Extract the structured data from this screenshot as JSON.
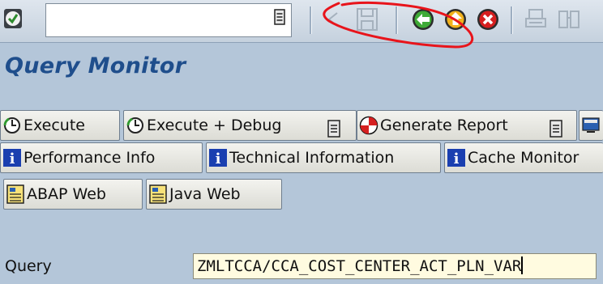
{
  "toolbar": {
    "command_field_value": "",
    "icons": [
      "enter-icon",
      "command-dropdown-icon",
      "back-triangle-icon",
      "save-icon",
      "back-icon",
      "exit-icon",
      "cancel-icon",
      "print-icon",
      "find-icon"
    ],
    "annotation_color": "#e8141b"
  },
  "page": {
    "title": "Query Monitor"
  },
  "buttons": {
    "execute": "Execute",
    "execute_debug": "Execute + Debug",
    "generate_report": "Generate Report",
    "performance_info": "Performance Info",
    "technical_information": "Technical Information",
    "cache_monitor": "Cache Monitor",
    "abap_web": "ABAP Web",
    "java_web": "Java Web"
  },
  "query": {
    "label": "Query",
    "value": "ZMLTCCA/CCA_COST_CENTER_ACT_PLN_VAR"
  },
  "colors": {
    "background": "#b4c6d9",
    "title": "#1f4e8c",
    "input_bg": "#fffbe0",
    "info_icon": "#1a3fb0"
  }
}
